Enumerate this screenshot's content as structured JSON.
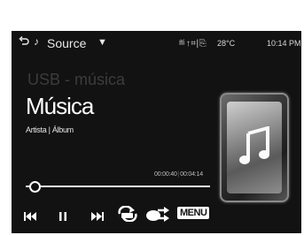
{
  "topbar": {
    "source_label": "Source",
    "status_icons": "≝↑⌗|⎘",
    "temperature": "28°C",
    "clock": "10:14 PM"
  },
  "player": {
    "source_ghost": "USB - música",
    "title": "Música",
    "artist_album": "Artista | Álbum",
    "elapsed": "00:00:40",
    "total": "00:04:14",
    "progress": 0.03
  },
  "controls": {
    "menu_label": "MENU"
  },
  "colors": {
    "screen_bg": "#121212",
    "text": "#ffffff",
    "ghost_text": "#3c3c3c"
  }
}
